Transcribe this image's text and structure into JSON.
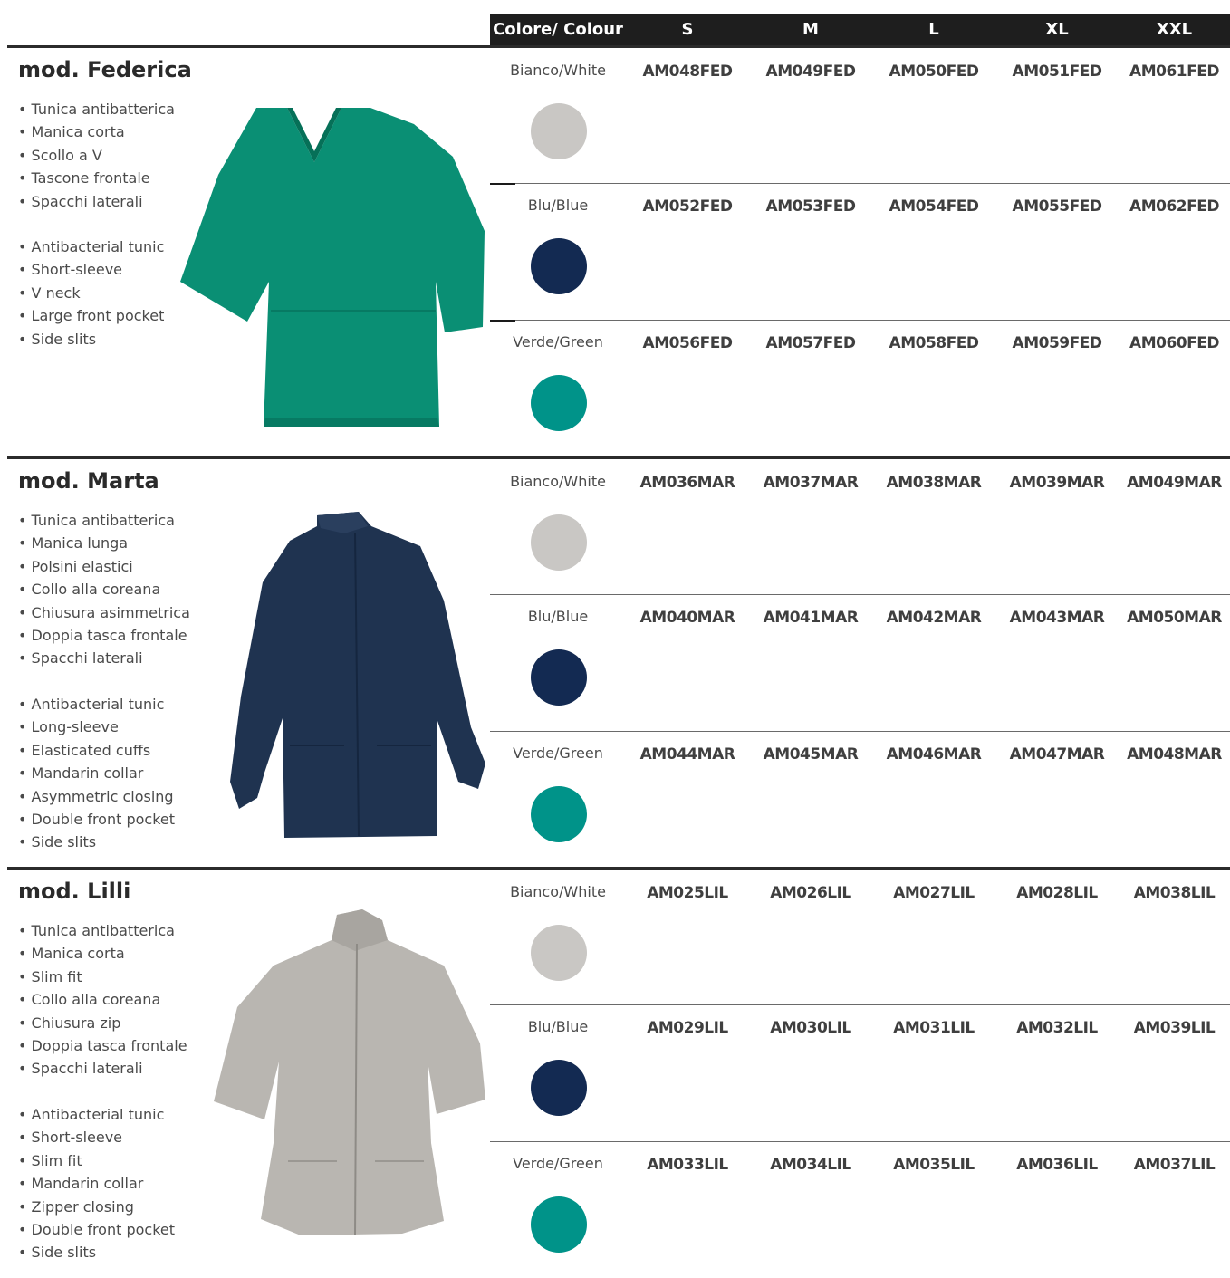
{
  "header": {
    "colour": "Colore/ Colour",
    "sizes": [
      "S",
      "M",
      "L",
      "XL",
      "XXL"
    ]
  },
  "colors": {
    "white": "#c9c7c4",
    "blue": "#132a52",
    "green": "#009389",
    "header_bg": "#1e1e1e"
  },
  "models": [
    {
      "title": "mod. Federica",
      "features_it": [
        "Tunica antibatterica",
        "Manica corta",
        "Scollo a V",
        "Tascone frontale",
        "Spacchi laterali"
      ],
      "features_en": [
        "Antibacterial tunic",
        "Short-sleeve",
        "V neck",
        "Large front pocket",
        "Side slits"
      ],
      "variants": [
        {
          "label": "Bianco/White",
          "codes": [
            "AM048FED",
            "AM049FED",
            "AM050FED",
            "AM051FED",
            "AM061FED"
          ]
        },
        {
          "label": "Blu/Blue",
          "codes": [
            "AM052FED",
            "AM053FED",
            "AM054FED",
            "AM055FED",
            "AM062FED"
          ]
        },
        {
          "label": "Verde/Green",
          "codes": [
            "AM056FED",
            "AM057FED",
            "AM058FED",
            "AM059FED",
            "AM060FED"
          ]
        }
      ]
    },
    {
      "title": "mod. Marta",
      "features_it": [
        "Tunica antibatterica",
        "Manica lunga",
        "Polsini elastici",
        "Collo alla coreana",
        "Chiusura asimmetrica",
        "Doppia tasca frontale",
        "Spacchi laterali"
      ],
      "features_en": [
        "Antibacterial tunic",
        "Long-sleeve",
        "Elasticated cuffs",
        "Mandarin collar",
        "Asymmetric closing",
        "Double front pocket",
        "Side slits"
      ],
      "variants": [
        {
          "label": "Bianco/White",
          "codes": [
            "AM036MAR",
            "AM037MAR",
            "AM038MAR",
            "AM039MAR",
            "AM049MAR"
          ]
        },
        {
          "label": "Blu/Blue",
          "codes": [
            "AM040MAR",
            "AM041MAR",
            "AM042MAR",
            "AM043MAR",
            "AM050MAR"
          ]
        },
        {
          "label": "Verde/Green",
          "codes": [
            "AM044MAR",
            "AM045MAR",
            "AM046MAR",
            "AM047MAR",
            "AM048MAR"
          ]
        }
      ]
    },
    {
      "title": "mod. Lilli",
      "features_it": [
        "Tunica antibatterica",
        "Manica corta",
        "Slim fit",
        "Collo alla coreana",
        "Chiusura zip",
        "Doppia tasca frontale",
        "Spacchi laterali"
      ],
      "features_en": [
        "Antibacterial tunic",
        "Short-sleeve",
        "Slim fit",
        "Mandarin collar",
        "Zipper closing",
        "Double front pocket",
        "Side slits"
      ],
      "variants": [
        {
          "label": "Bianco/White",
          "codes": [
            "AM025LIL",
            "AM026LIL",
            "AM027LIL",
            "AM028LIL",
            "AM038LIL"
          ]
        },
        {
          "label": "Blu/Blue",
          "codes": [
            "AM029LIL",
            "AM030LIL",
            "AM031LIL",
            "AM032LIL",
            "AM039LIL"
          ]
        },
        {
          "label": "Verde/Green",
          "codes": [
            "AM033LIL",
            "AM034LIL",
            "AM035LIL",
            "AM036LIL",
            "AM037LIL"
          ]
        }
      ]
    }
  ]
}
